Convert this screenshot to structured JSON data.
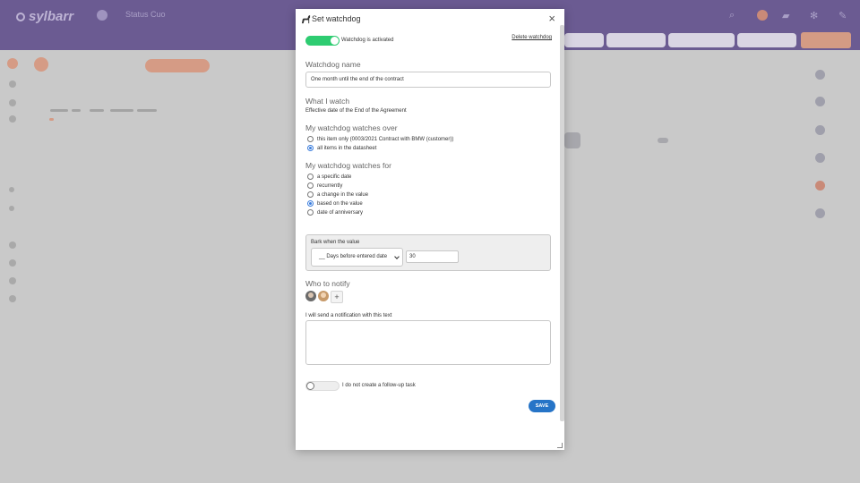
{
  "background_app": {
    "logo_text": "sylbarr",
    "breadcrumb": "Status Cuo"
  },
  "modal": {
    "title": "Set watchdog",
    "close_symbol": "×",
    "activation": {
      "label": "Watchdog is activated",
      "active": true
    },
    "delete_link": "Delete watchdog",
    "name_section": {
      "title": "Watchdog name",
      "value": "One month until the end of the contract"
    },
    "watch_section": {
      "title": "What I watch",
      "value": "Effective date of the End of the Agreement"
    },
    "scope_section": {
      "title": "My watchdog watches over",
      "options": [
        {
          "label": "this item only (0003/2021 Contract with BMW (customer))",
          "checked": false
        },
        {
          "label": "all items in the datasheet",
          "checked": true
        }
      ]
    },
    "trigger_section": {
      "title": "My watchdog watches for",
      "options": [
        {
          "label": "a specific date",
          "checked": false
        },
        {
          "label": "recurrently",
          "checked": false
        },
        {
          "label": "a change in the value",
          "checked": false
        },
        {
          "label": "based on the value",
          "checked": true
        },
        {
          "label": "date of anniversary",
          "checked": false
        }
      ]
    },
    "bark": {
      "label": "Bark when the value",
      "select_value": "__ Days before entered date",
      "input_value": "30"
    },
    "notify_section": {
      "title": "Who to notify",
      "add_symbol": "+"
    },
    "notification_text_label": "I will send a notification with this text",
    "notification_text_value": "",
    "followup": {
      "label": "I do not create a follow-up task",
      "active": false
    },
    "save_label": "SAVE"
  },
  "colors": {
    "header": "#6b5b92",
    "toggle_on": "#2ecc71",
    "save_button": "#2674c7",
    "radio_checked": "#3b7ddd"
  }
}
